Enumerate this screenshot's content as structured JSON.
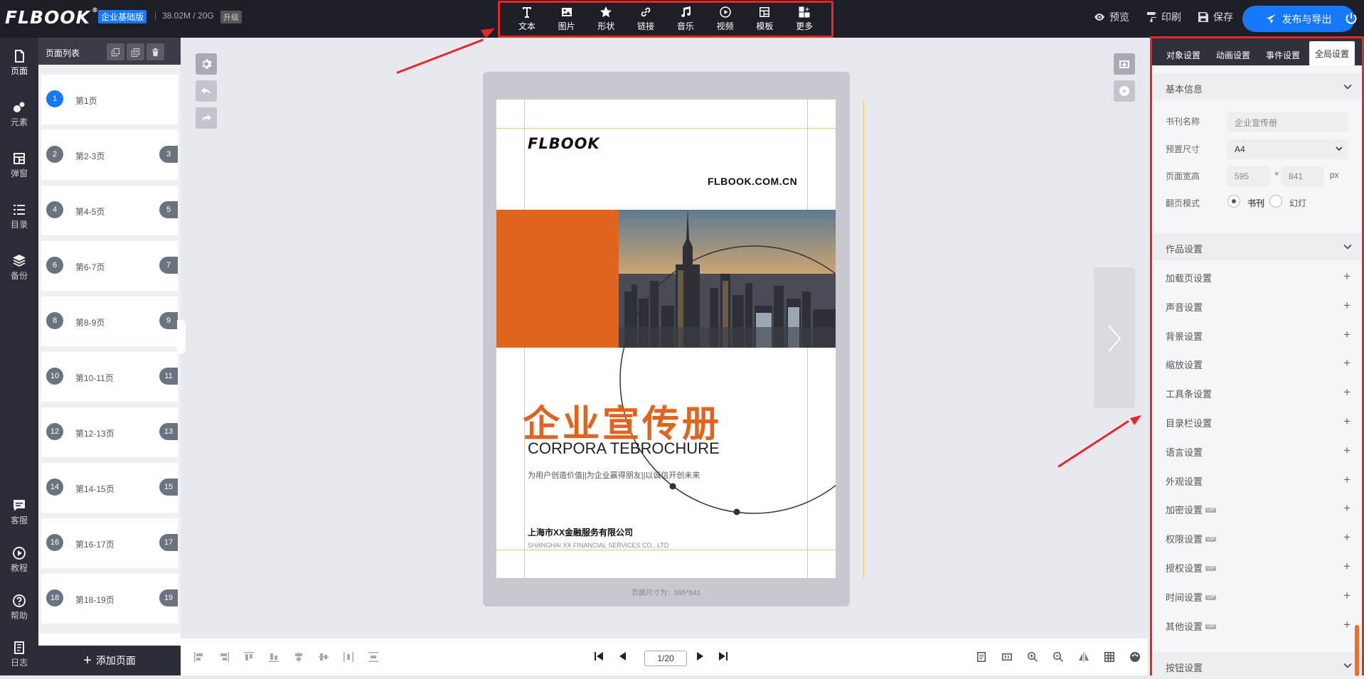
{
  "app": {
    "logo": "FLBOOK",
    "edition": "企业基础版",
    "storage": "38.02M / 20G",
    "upgrade": "升级"
  },
  "toolbar": {
    "text": "文本",
    "image": "图片",
    "shape": "形状",
    "link": "链接",
    "music": "音乐",
    "video": "视频",
    "template": "模板",
    "more": "更多"
  },
  "actions": {
    "preview": "预览",
    "print": "印刷",
    "save": "保存",
    "publish": "发布与导出"
  },
  "leftnav": {
    "page": "页面",
    "element": "元素",
    "popup": "弹窗",
    "toc": "目录",
    "backup": "备份",
    "service": "客服",
    "tutorial": "教程",
    "help": "帮助",
    "log": "日志"
  },
  "pagelist": {
    "title": "页面列表",
    "add": "添加页面",
    "pages": [
      {
        "label": "第1页",
        "left": "1",
        "right": ""
      },
      {
        "label": "第2-3页",
        "left": "2",
        "right": "3"
      },
      {
        "label": "第4-5页",
        "left": "4",
        "right": "5"
      },
      {
        "label": "第6-7页",
        "left": "6",
        "right": "7"
      },
      {
        "label": "第8-9页",
        "left": "8",
        "right": "9"
      },
      {
        "label": "第10-11页",
        "left": "10",
        "right": "11"
      },
      {
        "label": "第12-13页",
        "left": "12",
        "right": "13"
      },
      {
        "label": "第14-15页",
        "left": "14",
        "right": "15"
      },
      {
        "label": "第16-17页",
        "left": "16",
        "right": "17"
      },
      {
        "label": "第18-19页",
        "left": "18",
        "right": "19"
      }
    ]
  },
  "page": {
    "logo": "FLBOOK",
    "site": "FLBOOK.COM.CN",
    "title_cn": "企业宣传册",
    "title_en": "CORPORA TEBROCHURE",
    "slogan": "为用户创造价值||为企业赢得朋友||以诚信开创未来",
    "company_cn": "上海市XX金融服务有限公司",
    "company_en": "SHANGHAI XX FINANCIAL SERVICES CO., LTD",
    "size_text": "页面尺寸为：595*841",
    "accent": "#e0631e"
  },
  "pager": {
    "current": "1/20"
  },
  "panel": {
    "tabs": [
      "对象设置",
      "动画设置",
      "事件设置",
      "全局设置"
    ],
    "basic_title": "基本信息",
    "book_name_label": "书刊名称",
    "book_name_value": "企业宣传册",
    "preset_label": "预置尺寸",
    "preset_value": "A4",
    "size_label": "页面宽高",
    "width": "595",
    "times": "×",
    "height": "841",
    "unit": "px",
    "flip_label": "翻页模式",
    "flip_book": "书刊",
    "flip_slide": "幻灯",
    "work_title": "作品设置",
    "settings": [
      {
        "label": "加载页设置",
        "vip": ""
      },
      {
        "label": "声音设置",
        "vip": ""
      },
      {
        "label": "背景设置",
        "vip": ""
      },
      {
        "label": "缩放设置",
        "vip": ""
      },
      {
        "label": "工具条设置",
        "vip": ""
      },
      {
        "label": "目录栏设置",
        "vip": ""
      },
      {
        "label": "语言设置",
        "vip": ""
      },
      {
        "label": "外观设置",
        "vip": ""
      },
      {
        "label": "加密设置",
        "vip": "VIP"
      },
      {
        "label": "权限设置",
        "vip": "VIP"
      },
      {
        "label": "授权设置",
        "vip": "VIP"
      },
      {
        "label": "时间设置",
        "vip": "VIP"
      },
      {
        "label": "其他设置",
        "vip": "VIP"
      }
    ],
    "button_title": "按钮设置"
  }
}
